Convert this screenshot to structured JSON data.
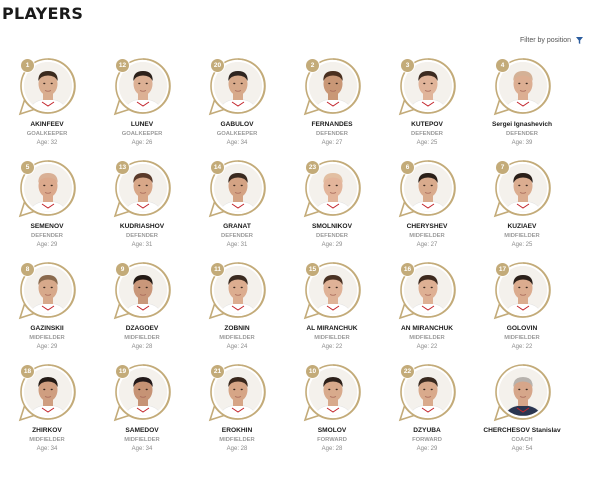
{
  "header": {
    "title": "PLAYERS",
    "filter_label": "Filter by position"
  },
  "age_prefix": "Age:",
  "colors": {
    "gold": "#c3ab79",
    "text": "#1a1a1a",
    "muted": "#9b9b9b",
    "filter_icon": "#2b5c9e"
  },
  "players": [
    {
      "number": "1",
      "name": "AKINFEEV",
      "position": "GOALKEEPER",
      "age": "32",
      "hair": "#3a2a1e",
      "skin": "#d9ad8f",
      "shirt": "#ffffff"
    },
    {
      "number": "12",
      "name": "LUNEV",
      "position": "GOALKEEPER",
      "age": "26",
      "hair": "#2c211b",
      "skin": "#dcb094",
      "shirt": "#ffffff"
    },
    {
      "number": "20",
      "name": "GABULOV",
      "position": "GOALKEEPER",
      "age": "34",
      "hair": "#2e2520",
      "skin": "#d7a98a",
      "shirt": "#ffffff"
    },
    {
      "number": "2",
      "name": "FERNANDES",
      "position": "DEFENDER",
      "age": "27",
      "hair": "#4a3020",
      "skin": "#c99776",
      "shirt": "#ffffff"
    },
    {
      "number": "3",
      "name": "KUTEPOV",
      "position": "DEFENDER",
      "age": "25",
      "hair": "#3b2a20",
      "skin": "#e0b49a",
      "shirt": "#ffffff"
    },
    {
      "number": "4",
      "name": "Sergei Ignashevich",
      "position": "DEFENDER",
      "age": "39",
      "hair": "#d4b196",
      "skin": "#dcae92",
      "shirt": "#ffffff"
    },
    {
      "number": "5",
      "name": "SEMENOV",
      "position": "DEFENDER",
      "age": "29",
      "hair": "#d9b095",
      "skin": "#dba98c",
      "shirt": "#ffffff"
    },
    {
      "number": "13",
      "name": "KUDRIASHOV",
      "position": "DEFENDER",
      "age": "31",
      "hair": "#5a3a2a",
      "skin": "#d8a788",
      "shirt": "#ffffff"
    },
    {
      "number": "14",
      "name": "GRANAT",
      "position": "DEFENDER",
      "age": "31",
      "hair": "#3a2a20",
      "skin": "#d4a384",
      "shirt": "#ffffff"
    },
    {
      "number": "23",
      "name": "SMOLNIKOV",
      "position": "DEFENDER",
      "age": "29",
      "hair": "#e2bfa2",
      "skin": "#e3b59b",
      "shirt": "#ffffff"
    },
    {
      "number": "6",
      "name": "CHERYSHEV",
      "position": "MIDFIELDER",
      "age": "27",
      "hair": "#2b2019",
      "skin": "#d9ab8d",
      "shirt": "#ffffff"
    },
    {
      "number": "7",
      "name": "KUZIAEV",
      "position": "MIDFIELDER",
      "age": "25",
      "hair": "#2a1f19",
      "skin": "#dbad90",
      "shirt": "#ffffff"
    },
    {
      "number": "8",
      "name": "GAZINSKII",
      "position": "MIDFIELDER",
      "age": "29",
      "hair": "#8a6a4e",
      "skin": "#d7a98b",
      "shirt": "#ffffff"
    },
    {
      "number": "9",
      "name": "DZAGOEV",
      "position": "MIDFIELDER",
      "age": "28",
      "hair": "#241a15",
      "skin": "#c9977a",
      "shirt": "#ffffff"
    },
    {
      "number": "11",
      "name": "ZOBNIN",
      "position": "MIDFIELDER",
      "age": "24",
      "hair": "#3b2b21",
      "skin": "#dcad90",
      "shirt": "#ffffff"
    },
    {
      "number": "15",
      "name": "AL MIRANCHUK",
      "position": "MIDFIELDER",
      "age": "22",
      "hair": "#4a3224",
      "skin": "#dfb297",
      "shirt": "#ffffff"
    },
    {
      "number": "16",
      "name": "AN MIRANCHUK",
      "position": "MIDFIELDER",
      "age": "22",
      "hair": "#3e2a1f",
      "skin": "#deb094",
      "shirt": "#ffffff"
    },
    {
      "number": "17",
      "name": "GOLOVIN",
      "position": "MIDFIELDER",
      "age": "22",
      "hair": "#2b201a",
      "skin": "#dbac8f",
      "shirt": "#ffffff"
    },
    {
      "number": "18",
      "name": "ZHIRKOV",
      "position": "MIDFIELDER",
      "age": "34",
      "hair": "#241b16",
      "skin": "#cf9e80",
      "shirt": "#ffffff"
    },
    {
      "number": "19",
      "name": "SAMEDOV",
      "position": "MIDFIELDER",
      "age": "34",
      "hair": "#22191a",
      "skin": "#c69375",
      "shirt": "#ffffff"
    },
    {
      "number": "21",
      "name": "EROKHIN",
      "position": "MIDFIELDER",
      "age": "28",
      "hair": "#3a281d",
      "skin": "#d6a586",
      "shirt": "#ffffff"
    },
    {
      "number": "10",
      "name": "SMOLOV",
      "position": "FORWARD",
      "age": "28",
      "hair": "#2c201a",
      "skin": "#d8aa8c",
      "shirt": "#ffffff"
    },
    {
      "number": "22",
      "name": "DZYUBA",
      "position": "FORWARD",
      "age": "29",
      "hair": "#3a2a20",
      "skin": "#d9aa8c",
      "shirt": "#ffffff"
    },
    {
      "number": "",
      "name": "CHERCHESOV Stanislav",
      "position": "COACH",
      "age": "54",
      "hair": "#b7b2ad",
      "skin": "#d6a68a",
      "shirt": "#2a3550"
    }
  ]
}
